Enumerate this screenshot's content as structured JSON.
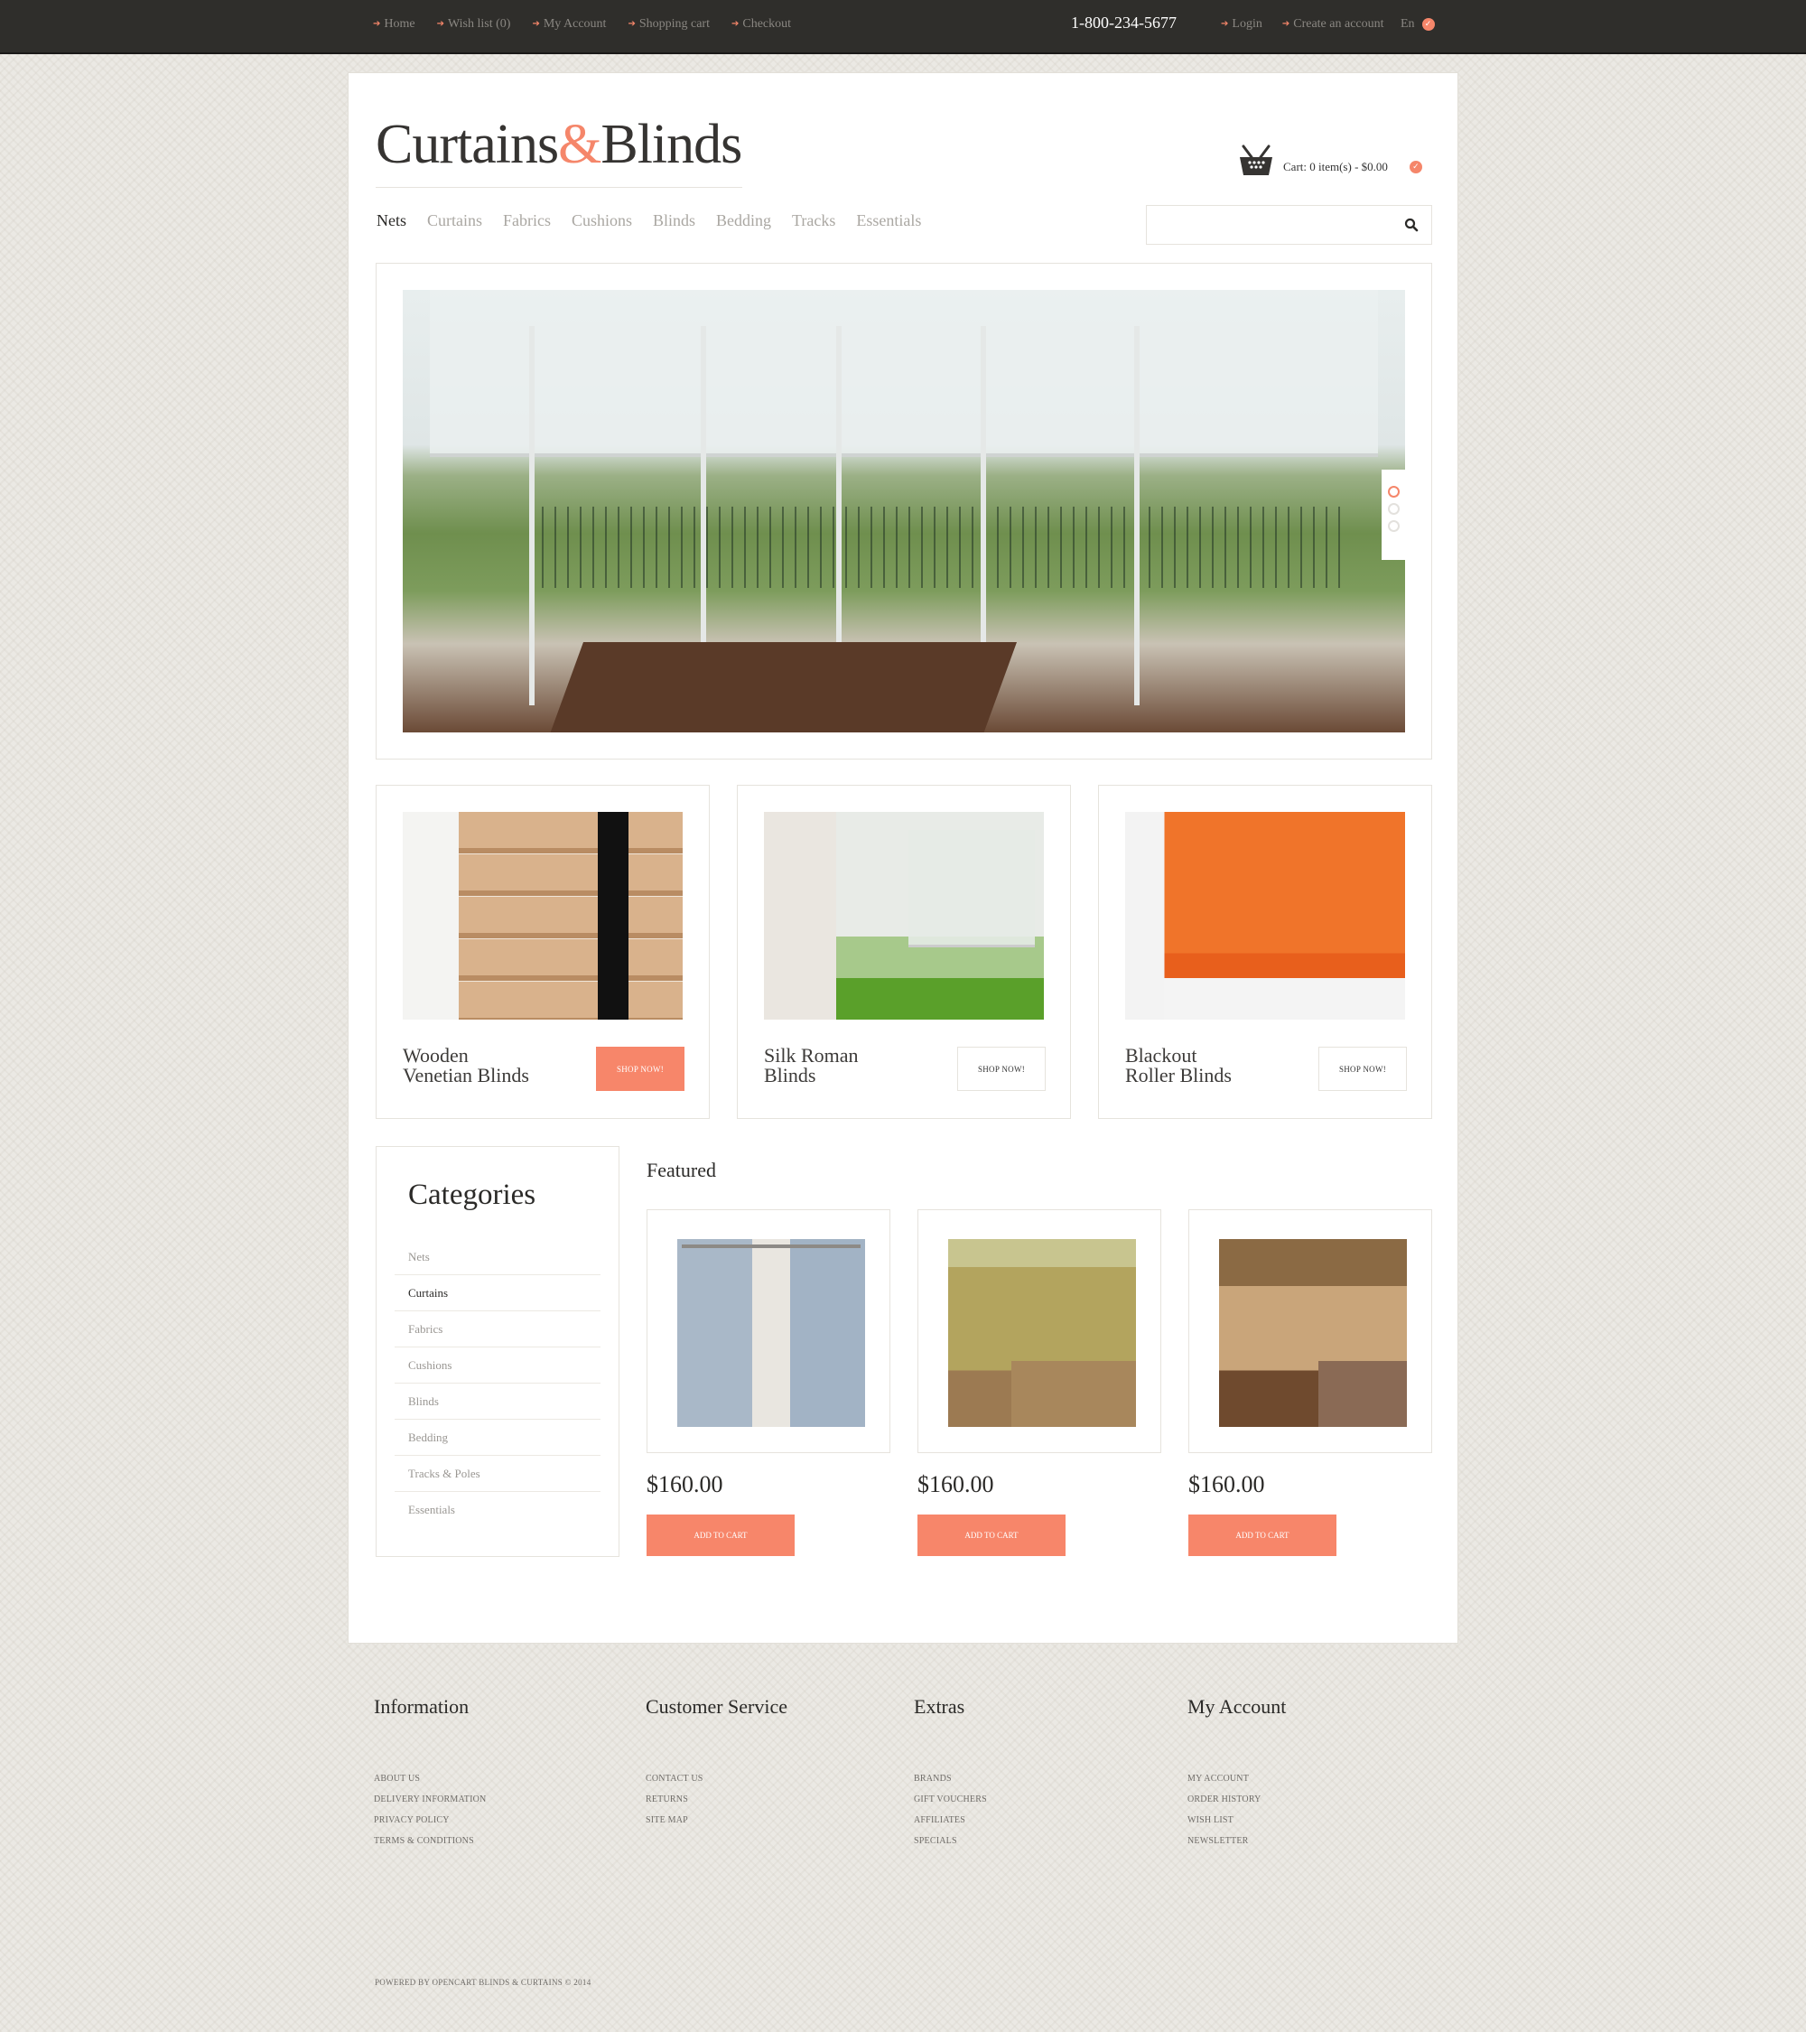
{
  "topbar": {
    "links_left": [
      {
        "label": "Home",
        "icon": "arrow-right-icon"
      },
      {
        "label": "Wish list (0)",
        "icon": "arrow-right-icon"
      },
      {
        "label": "My Account",
        "icon": "arrow-right-icon"
      },
      {
        "label": "Shopping cart",
        "icon": "arrow-right-icon"
      },
      {
        "label": "Checkout",
        "icon": "arrow-right-icon"
      }
    ],
    "phone": "1-800-234-5677",
    "links_right": [
      {
        "label": "Login",
        "icon": "arrow-right-icon"
      },
      {
        "label": "Create an account",
        "icon": "arrow-right-icon"
      }
    ],
    "language": "En"
  },
  "header": {
    "logo_part1": "Curtains",
    "logo_amp": "&",
    "logo_part2": "Blinds",
    "cart_text": "Cart: 0 item(s) - $0.00",
    "search_placeholder": "",
    "search_value": ""
  },
  "nav": {
    "items": [
      {
        "label": "Nets",
        "active": true
      },
      {
        "label": "Curtains"
      },
      {
        "label": "Fabrics"
      },
      {
        "label": "Cushions"
      },
      {
        "label": "Blinds"
      },
      {
        "label": "Bedding"
      },
      {
        "label": "Tracks"
      },
      {
        "label": "Essentials"
      }
    ]
  },
  "slider": {
    "slide_count": 3,
    "active_slide": 1,
    "image_alt": "Dining room with sheer roller blinds overlooking garden"
  },
  "promos": [
    {
      "title_line1": "Wooden",
      "title_line2": "Venetian Blinds",
      "button": "SHOP NOW!",
      "primary": true
    },
    {
      "title_line1": "Silk Roman",
      "title_line2": "Blinds",
      "button": "SHOP NOW!",
      "primary": false
    },
    {
      "title_line1": "Blackout",
      "title_line2": "Roller Blinds",
      "button": "SHOP NOW!",
      "primary": false
    }
  ],
  "categories": {
    "title": "Categories",
    "items": [
      {
        "label": "Nets"
      },
      {
        "label": "Curtains",
        "active": true
      },
      {
        "label": "Fabrics"
      },
      {
        "label": "Cushions"
      },
      {
        "label": "Blinds"
      },
      {
        "label": "Bedding"
      },
      {
        "label": "Tracks & Poles"
      },
      {
        "label": "Essentials"
      }
    ]
  },
  "featured": {
    "title": "Featured",
    "products": [
      {
        "price": "$160.00",
        "button": "ADD TO CART",
        "image": "blue patterned curtains"
      },
      {
        "price": "$160.00",
        "button": "ADD TO CART",
        "image": "living room with vertical blinds"
      },
      {
        "price": "$160.00",
        "button": "ADD TO CART",
        "image": "bedroom with roller shades"
      }
    ]
  },
  "footer": {
    "columns": [
      {
        "title": "Information",
        "links": [
          "ABOUT US",
          "DELIVERY INFORMATION",
          "PRIVACY POLICY",
          "TERMS & CONDITIONS"
        ]
      },
      {
        "title": "Customer Service",
        "links": [
          "CONTACT US",
          "RETURNS",
          "SITE MAP"
        ]
      },
      {
        "title": "Extras",
        "links": [
          "BRANDS",
          "GIFT VOUCHERS",
          "AFFILIATES",
          "SPECIALS"
        ]
      },
      {
        "title": "My Account",
        "links": [
          "MY ACCOUNT",
          "ORDER HISTORY",
          "WISH LIST",
          "NEWSLETTER"
        ]
      }
    ],
    "copyright": "POWERED BY OPENCART BLINDS & CURTAINS © 2014"
  },
  "colors": {
    "accent": "#f7866a",
    "topbar_bg": "#2f2e2b",
    "text_dark": "#2b2a28",
    "text_muted": "#aaa7a2"
  }
}
